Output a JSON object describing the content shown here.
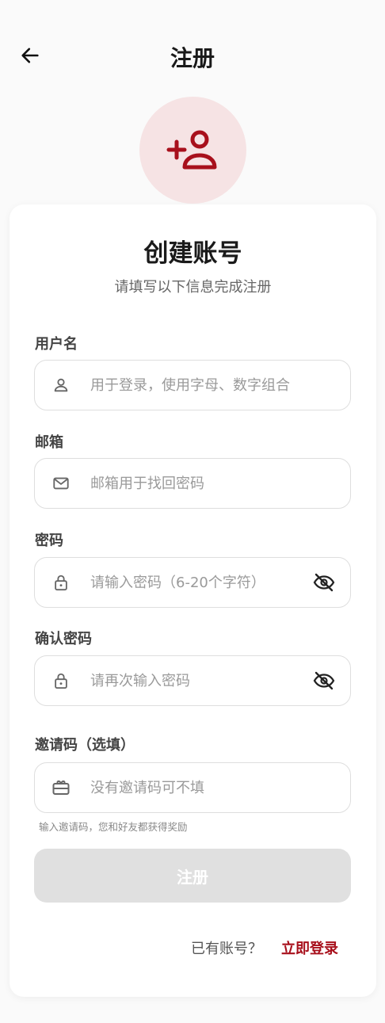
{
  "header": {
    "title": "注册",
    "back_icon": "arrow-left-icon"
  },
  "avatar": {
    "icon": "person-add-icon"
  },
  "colors": {
    "accent": "#a8101c",
    "avatar_bg": "#f6e3e4",
    "button_disabled": "#e0e0e0"
  },
  "card": {
    "title": "创建账号",
    "subtitle": "请填写以下信息完成注册"
  },
  "form": {
    "username": {
      "label": "用户名",
      "placeholder": "用于登录，使用字母、数字组合",
      "value": "",
      "icon": "person-icon"
    },
    "email": {
      "label": "邮箱",
      "placeholder": "邮箱用于找回密码",
      "value": "",
      "icon": "mail-icon"
    },
    "password": {
      "label": "密码",
      "placeholder": "请输入密码（6-20个字符）",
      "value": "",
      "icon": "lock-icon",
      "toggle_icon": "eye-off-icon"
    },
    "confirm_password": {
      "label": "确认密码",
      "placeholder": "请再次输入密码",
      "value": "",
      "icon": "lock-icon",
      "toggle_icon": "eye-off-icon"
    },
    "invite_code": {
      "label": "邀请码（选填）",
      "placeholder": "没有邀请码可不填",
      "value": "",
      "icon": "gift-card-icon",
      "hint": "输入邀请码，您和好友都获得奖励"
    }
  },
  "submit": {
    "label": "注册"
  },
  "footer": {
    "prompt": "已有账号？",
    "login_link": "立即登录"
  }
}
